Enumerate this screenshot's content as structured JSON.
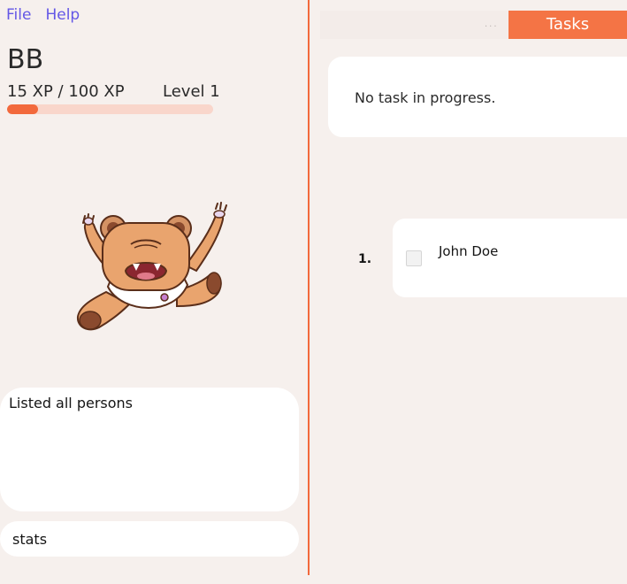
{
  "menu": {
    "file_label": "File",
    "help_label": "Help"
  },
  "pet": {
    "name": "BB",
    "xp_text": "15 XP / 100 XP",
    "level_text": "Level 1",
    "xp_fraction": 0.15
  },
  "result": {
    "text": "Listed all persons"
  },
  "command": {
    "value": "stats"
  },
  "tabs": {
    "tasks_label": "Tasks",
    "overflow_label": "..."
  },
  "progress": {
    "text": "No task in progress."
  },
  "tasks": [
    {
      "index": "1.",
      "name": "John Doe",
      "done": false
    }
  ],
  "colors": {
    "accent": "#f2693c",
    "menu": "#6457e6",
    "background": "#f6f0ed"
  }
}
